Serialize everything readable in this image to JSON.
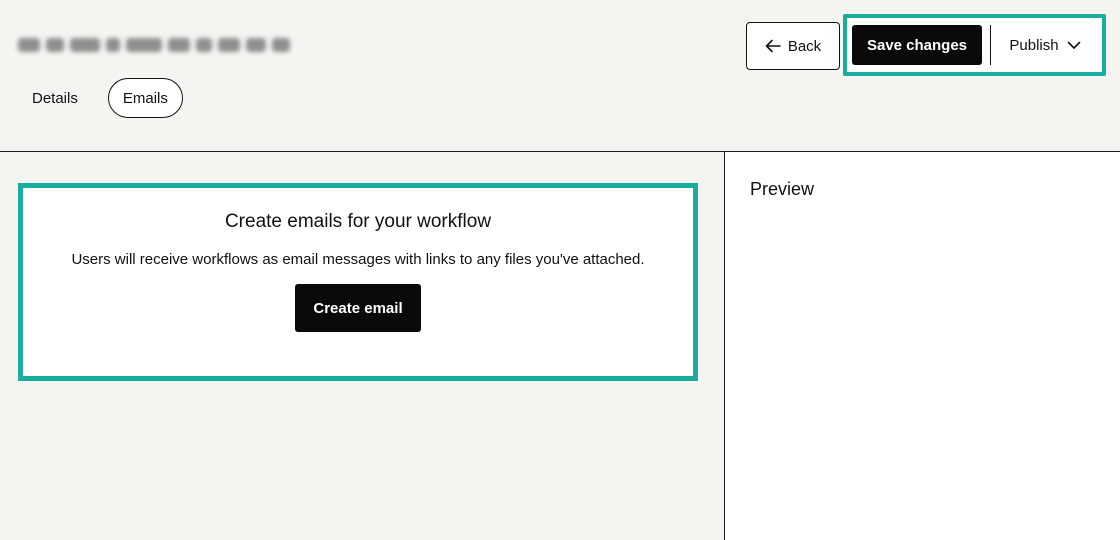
{
  "header": {
    "tabs": [
      {
        "label": "Details",
        "active": false
      },
      {
        "label": "Emails",
        "active": true
      }
    ],
    "back_label": "Back",
    "save_label": "Save changes",
    "publish_label": "Publish"
  },
  "main": {
    "empty_title": "Create emails for your workflow",
    "empty_description": "Users will receive workflows as email messages with links to any files you've attached.",
    "create_label": "Create email"
  },
  "preview": {
    "title": "Preview"
  },
  "icons": {
    "back": "arrow-left-icon",
    "publish": "chevron-down-icon"
  },
  "colors": {
    "highlight": "#19ada0",
    "primary_button": "#0a0a0a",
    "page_background": "#f4f4f0"
  }
}
